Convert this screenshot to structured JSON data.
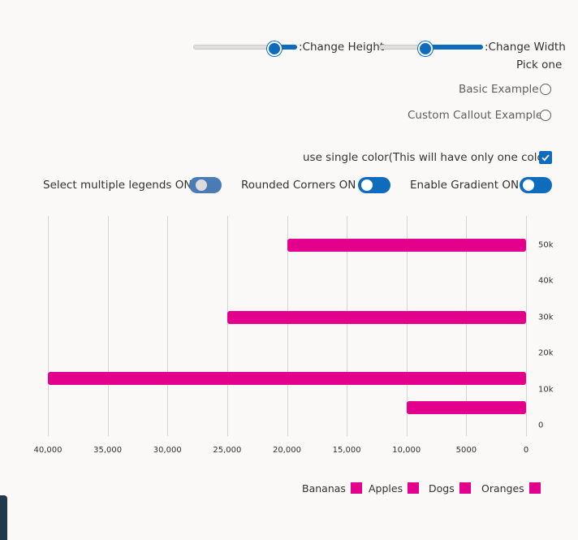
{
  "controls": {
    "height_label": ":Change Height",
    "width_label": ":Change Width",
    "height_value": 0.75,
    "width_value": 0.45,
    "radio_group_label": "Pick one",
    "radio_options": [
      "Basic Example",
      "Custom Callout Example"
    ],
    "single_color_label": "use single color(This will have only one color)",
    "single_color_checked": true,
    "toggles": [
      {
        "label": "Select multiple legends ON",
        "on": true
      },
      {
        "label": "Rounded Corners ON",
        "on": true
      },
      {
        "label": "Enable Gradient ON",
        "on": true
      }
    ]
  },
  "colors": {
    "accent": "#0f6cbd",
    "bar": "#e3008c"
  },
  "chart_data": {
    "type": "bar",
    "orientation": "horizontal",
    "x_axis_reversed": true,
    "y_axis_position": "right",
    "xlim": [
      0,
      40000
    ],
    "ylim": [
      0,
      50000
    ],
    "x_tick_labels": [
      "40,000",
      "35,000",
      "30,000",
      "25,000",
      "20,000",
      "15,000",
      "10,000",
      "5000",
      "0"
    ],
    "y_tick_labels": [
      "50k",
      "40k",
      "30k",
      "20k",
      "10k",
      "0"
    ],
    "bars": [
      {
        "legend": "Bananas",
        "y": 50000,
        "x": 20000
      },
      {
        "legend": "Apples",
        "y": 30000,
        "x": 25000
      },
      {
        "legend": "Dogs",
        "y": 13000,
        "x": 40000
      },
      {
        "legend": "Oranges",
        "y": 5000,
        "x": 10000
      }
    ],
    "legend_placement": "bottom-right",
    "grid": true
  }
}
